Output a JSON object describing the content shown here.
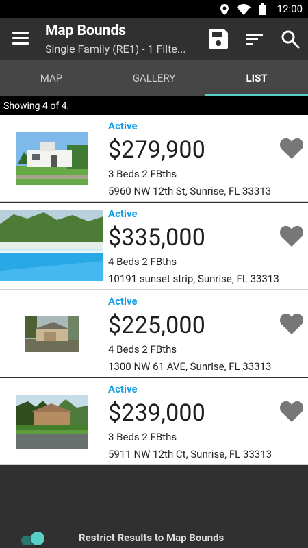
{
  "status_bar": {
    "time": "12:00"
  },
  "app": {
    "title": "Map Bounds",
    "subtitle": "Single Family (RE1) - 1 Filte...",
    "accent_color": "#57d0c8",
    "active_color": "#189fe4"
  },
  "tabs": [
    {
      "label": "MAP"
    },
    {
      "label": "GALLERY"
    },
    {
      "label": "LIST"
    }
  ],
  "list": {
    "summary": "Showing 4 of 4.",
    "items": [
      {
        "status": "Active",
        "price": "$279,900",
        "beds_baths": "3 Beds 2 FBths",
        "address": "5960 NW 12th St, Sunrise, FL 33313",
        "photo": "white-house"
      },
      {
        "status": "Active",
        "price": "$335,000",
        "beds_baths": "4 Beds 2 FBths",
        "address": "10191 sunset strip, Sunrise, FL 33313",
        "photo": "pool"
      },
      {
        "status": "Active",
        "price": "$225,000",
        "beds_baths": "4 Beds 2 FBths",
        "address": "1300 NW 61 AVE, Sunrise, FL 33313",
        "photo": "small-house"
      },
      {
        "status": "Active",
        "price": "$239,000",
        "beds_baths": "3 Beds 2 FBths",
        "address": "5911 NW 12th Ct, Sunrise, FL 33313",
        "photo": "ranch-house"
      }
    ]
  },
  "footer": {
    "toggle_label": "Restrict Results to Map Bounds",
    "toggle_on": true
  }
}
